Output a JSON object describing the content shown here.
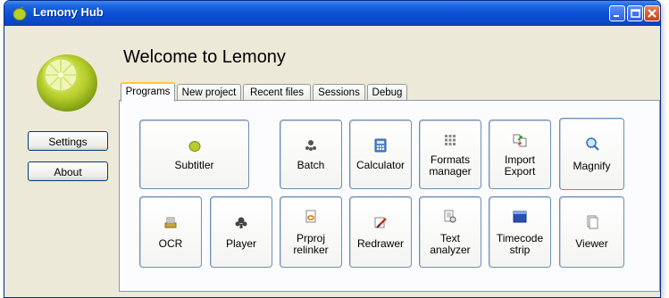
{
  "window": {
    "title": "Lemony Hub"
  },
  "sidebar": {
    "settings_label": "Settings",
    "about_label": "About"
  },
  "main": {
    "heading": "Welcome to Lemony",
    "tabs": [
      "Programs",
      "New project",
      "Recent files",
      "Sessions",
      "Debug"
    ],
    "active_tab": "Programs"
  },
  "programs": {
    "subtitler": "Subtitler",
    "batch": "Batch",
    "calculator": "Calculator",
    "formats_manager": [
      "Formats",
      "manager"
    ],
    "import_export": [
      "Import",
      "Export"
    ],
    "magnify": "Magnify",
    "ocr": "OCR",
    "player": "Player",
    "prproj_relinker": [
      "Prproj",
      "relinker"
    ],
    "redrawer": "Redrawer",
    "text_analyzer": [
      "Text",
      "analyzer"
    ],
    "timecode_strip": [
      "Timecode",
      "strip"
    ],
    "viewer": "Viewer"
  },
  "colors": {
    "titlebar": "#0a4fd6",
    "window_bg": "#ece9d8",
    "active_tab_accent": "#ffc83c",
    "button_border": "#6d8fb4"
  }
}
